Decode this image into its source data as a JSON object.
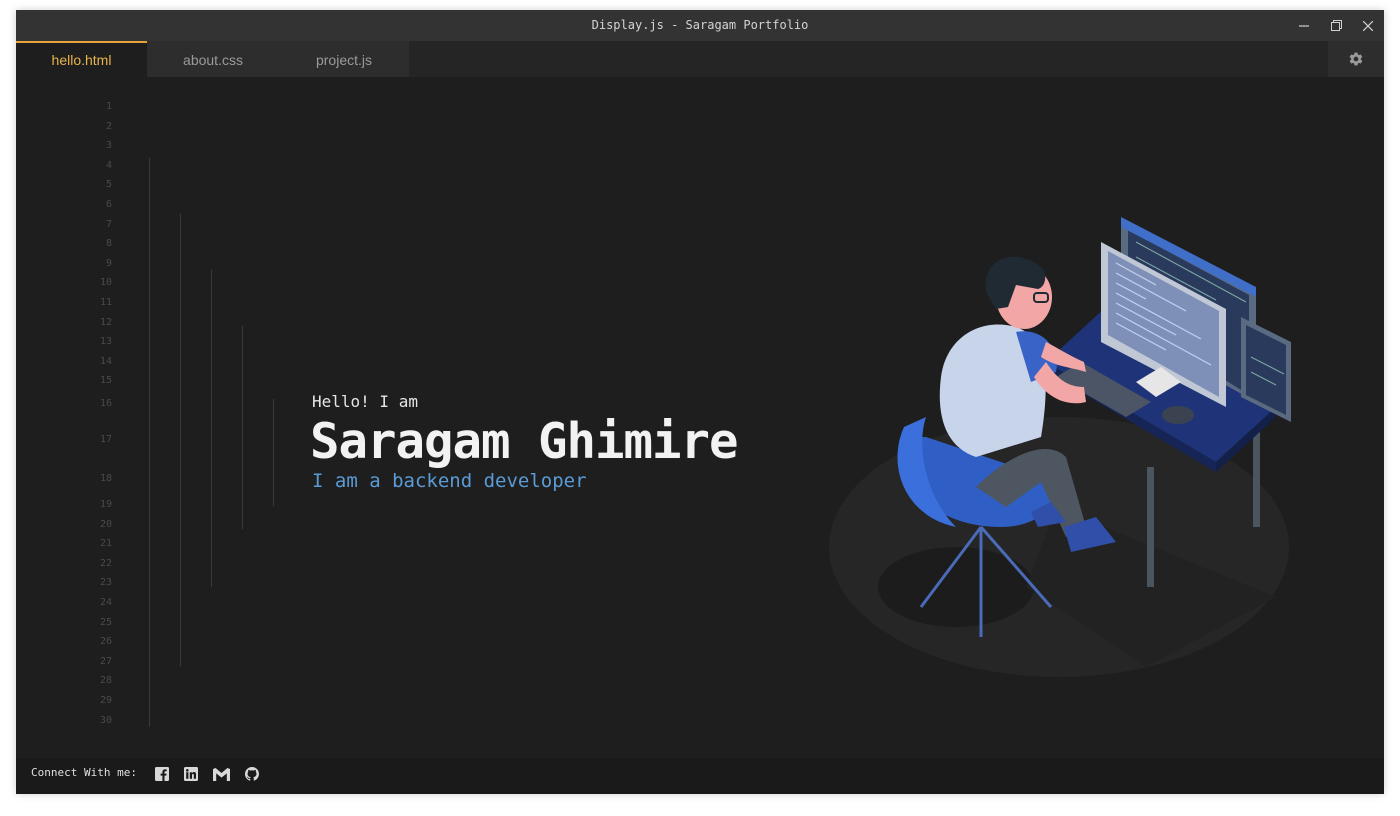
{
  "window": {
    "title": "Display.js - Saragam Portfolio"
  },
  "tabs": [
    {
      "label": "hello.html",
      "active": true
    },
    {
      "label": "about.css",
      "active": false
    },
    {
      "label": "project.js",
      "active": false
    }
  ],
  "gutter": {
    "line_numbers": [
      "1",
      "2",
      "3",
      "4",
      "5",
      "6",
      "7",
      "8",
      "9",
      "10",
      "11",
      "12",
      "13",
      "14",
      "15",
      "16",
      "17",
      "18",
      "19",
      "20",
      "21",
      "22",
      "23",
      "24",
      "25",
      "26",
      "27",
      "28",
      "29",
      "30"
    ]
  },
  "hero": {
    "greeting": "Hello! I am",
    "name": "Saragam Ghimire",
    "role": "I am a backend developer"
  },
  "footer": {
    "connect_label": "Connect With me:",
    "social_icons": [
      "facebook-icon",
      "linkedin-icon",
      "gmail-icon",
      "github-icon"
    ]
  },
  "colors": {
    "accent_tab": "#e8b44a",
    "role_text": "#5b9bd5",
    "desk": "#1f3478"
  }
}
